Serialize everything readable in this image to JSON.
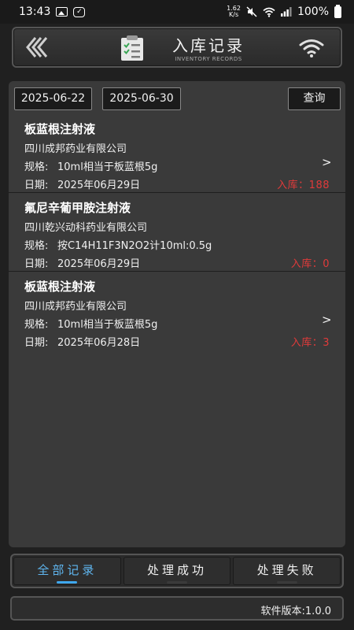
{
  "status_bar": {
    "time": "13:43",
    "net_speed_value": "1.62",
    "net_speed_unit": "K/s",
    "battery": "100%"
  },
  "header": {
    "title": "入库记录",
    "subtitle": "INVENTORY RECORDS",
    "back_icon": "double-chevron-left-icon",
    "wifi_icon": "wifi-icon"
  },
  "filter": {
    "start_date": "2025-06-22",
    "end_date": "2025-06-30",
    "query_label": "查询"
  },
  "labels": {
    "spec": "规格:",
    "date": "日期:",
    "arrow": ">"
  },
  "records": [
    {
      "name": "板蓝根注射液",
      "company": "四川成邦药业有限公司",
      "spec": "10ml相当于板蓝根5g",
      "date": "2025年06月29日",
      "qty": "入库：188"
    },
    {
      "name": "氟尼辛葡甲胺注射液",
      "company": "四川乾兴动科药业有限公司",
      "spec": "按C14H11F3N2O2计10ml:0.5g",
      "date": "2025年06月29日",
      "qty": "入库：0"
    },
    {
      "name": "板蓝根注射液",
      "company": "四川成邦药业有限公司",
      "spec": "10ml相当于板蓝根5g",
      "date": "2025年06月28日",
      "qty": "入库：3"
    }
  ],
  "tabs": [
    {
      "label": "全部记录",
      "active": true
    },
    {
      "label": "处理成功",
      "active": false
    },
    {
      "label": "处理失败",
      "active": false
    }
  ],
  "footer": {
    "version": "软件版本:1.0.0"
  },
  "colors": {
    "background": "#202020",
    "panel": "#3a3a3a",
    "accent": "#3fa8ee",
    "qty_red": "#e03a3a"
  }
}
